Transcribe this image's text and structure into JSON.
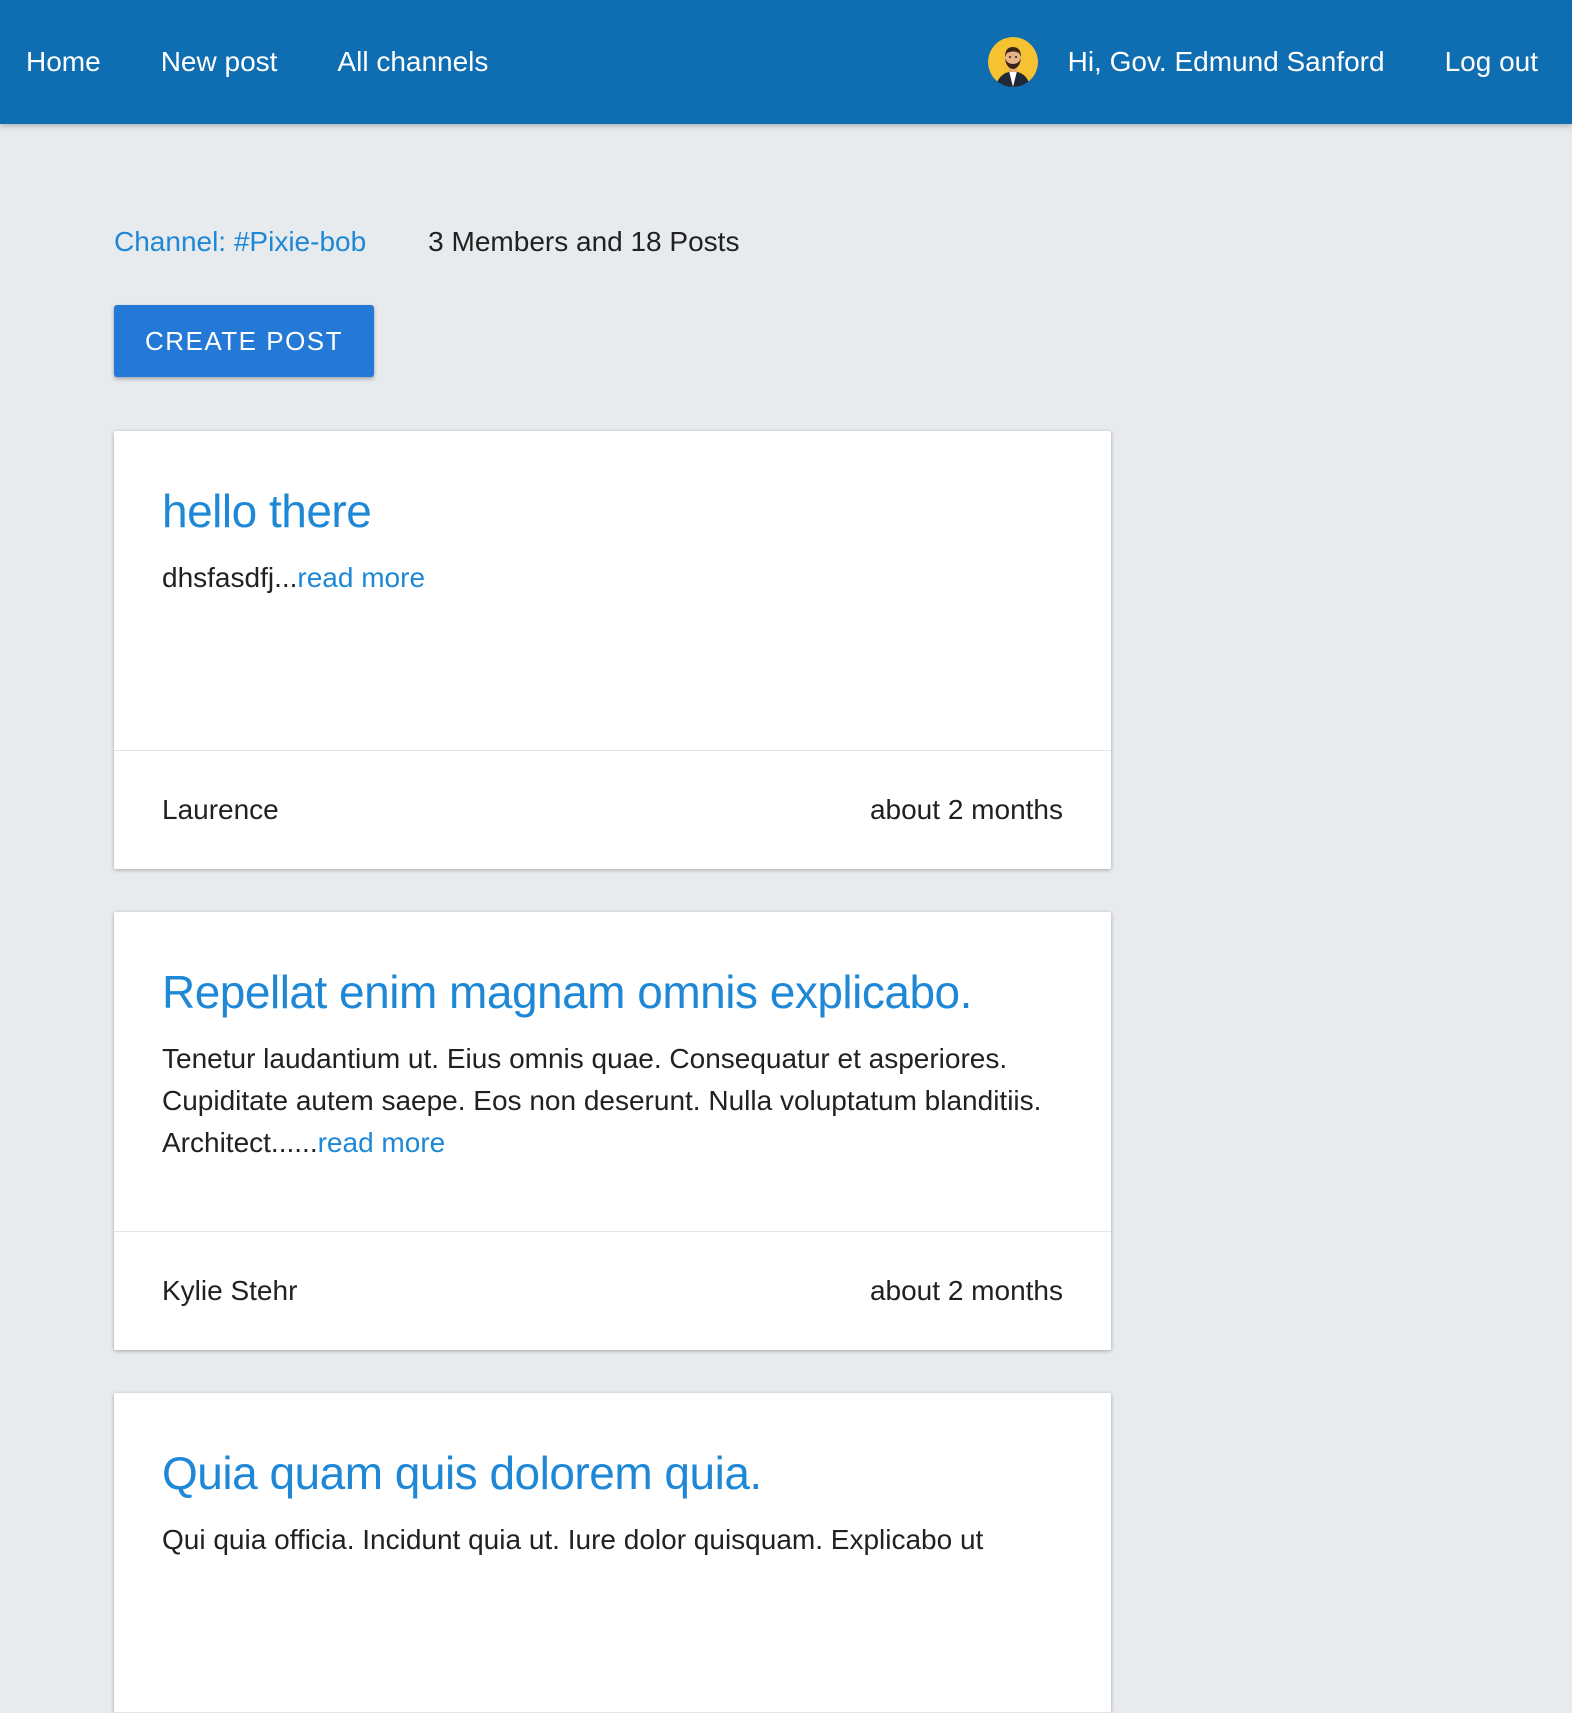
{
  "navbar": {
    "home_label": "Home",
    "new_post_label": "New post",
    "all_channels_label": "All channels",
    "greeting": "Hi, Gov. Edmund Sanford",
    "logout_label": "Log out",
    "avatar_icon": "user-avatar-icon"
  },
  "channel": {
    "name": "Channel: #Pixie-bob",
    "stats": "3 Members and 18 Posts",
    "create_post_label": "CREATE POST"
  },
  "posts": [
    {
      "title": "hello there",
      "excerpt": "dhsfasdfj...",
      "read_more": "read more",
      "author": "Laurence",
      "time": "about 2 months"
    },
    {
      "title": "Repellat enim magnam omnis explicabo.",
      "excerpt": "Tenetur laudantium ut. Eius omnis quae. Consequatur et asperiores. Cupiditate autem saepe. Eos non deserunt. Nulla voluptatum blanditiis. Architect......",
      "read_more": "read more",
      "author": "Kylie Stehr",
      "time": "about 2 months"
    },
    {
      "title": "Quia quam quis dolorem quia.",
      "excerpt": "Qui quia officia. Incidunt quia ut. Iure dolor quisquam. Explicabo ut"
    }
  ],
  "colors": {
    "navbar": "#0f6db1",
    "accent": "#1e88d6",
    "button": "#2479d6",
    "background": "#e8ebee"
  }
}
